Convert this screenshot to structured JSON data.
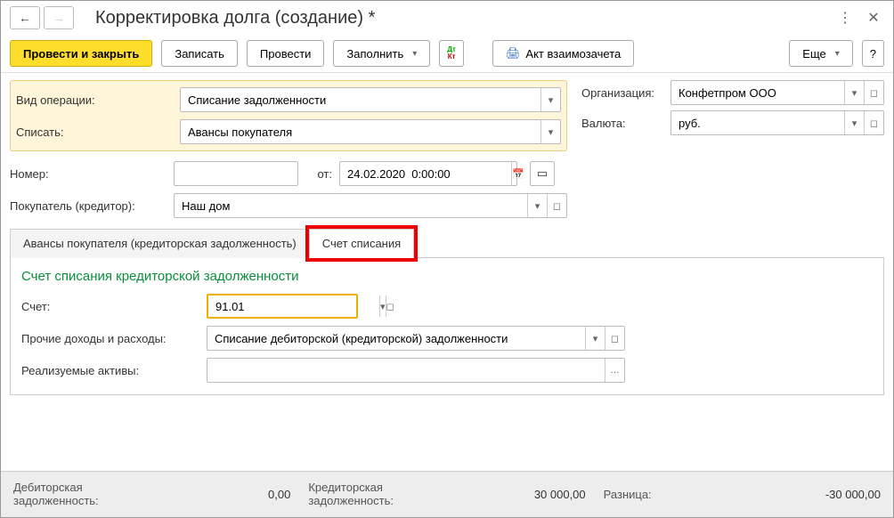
{
  "header": {
    "title": "Корректировка долга (создание) *"
  },
  "toolbar": {
    "post_close": "Провести и закрыть",
    "save": "Записать",
    "post": "Провести",
    "fill": "Заполнить",
    "act": "Акт взаимозачета",
    "more": "Еще",
    "help": "?"
  },
  "fields": {
    "op_type_label": "Вид операции:",
    "op_type_value": "Списание задолженности",
    "writeoff_label": "Списать:",
    "writeoff_value": "Авансы покупателя",
    "org_label": "Организация:",
    "org_value": "Конфетпром ООО",
    "currency_label": "Валюта:",
    "currency_value": "руб.",
    "number_label": "Номер:",
    "number_value": "",
    "date_label": "от:",
    "date_value": "24.02.2020  0:00:00",
    "buyer_label": "Покупатель (кредитор):",
    "buyer_value": "Наш дом"
  },
  "tabs": {
    "tab1": "Авансы покупателя (кредиторская задолженность)",
    "tab2": "Счет списания"
  },
  "section": {
    "title": "Счет списания кредиторской задолженности",
    "account_label": "Счет:",
    "account_value": "91.01",
    "other_label": "Прочие доходы и расходы:",
    "other_value": "Списание дебиторской (кредиторской) задолженности",
    "assets_label": "Реализуемые активы:",
    "assets_value": ""
  },
  "footer": {
    "debit_label": "Дебиторская\nзадолженность:",
    "debit_value": "0,00",
    "credit_label": "Кредиторская\nзадолженность:",
    "credit_value": "30 000,00",
    "diff_label": "Разница:",
    "diff_value": "-30 000,00"
  }
}
